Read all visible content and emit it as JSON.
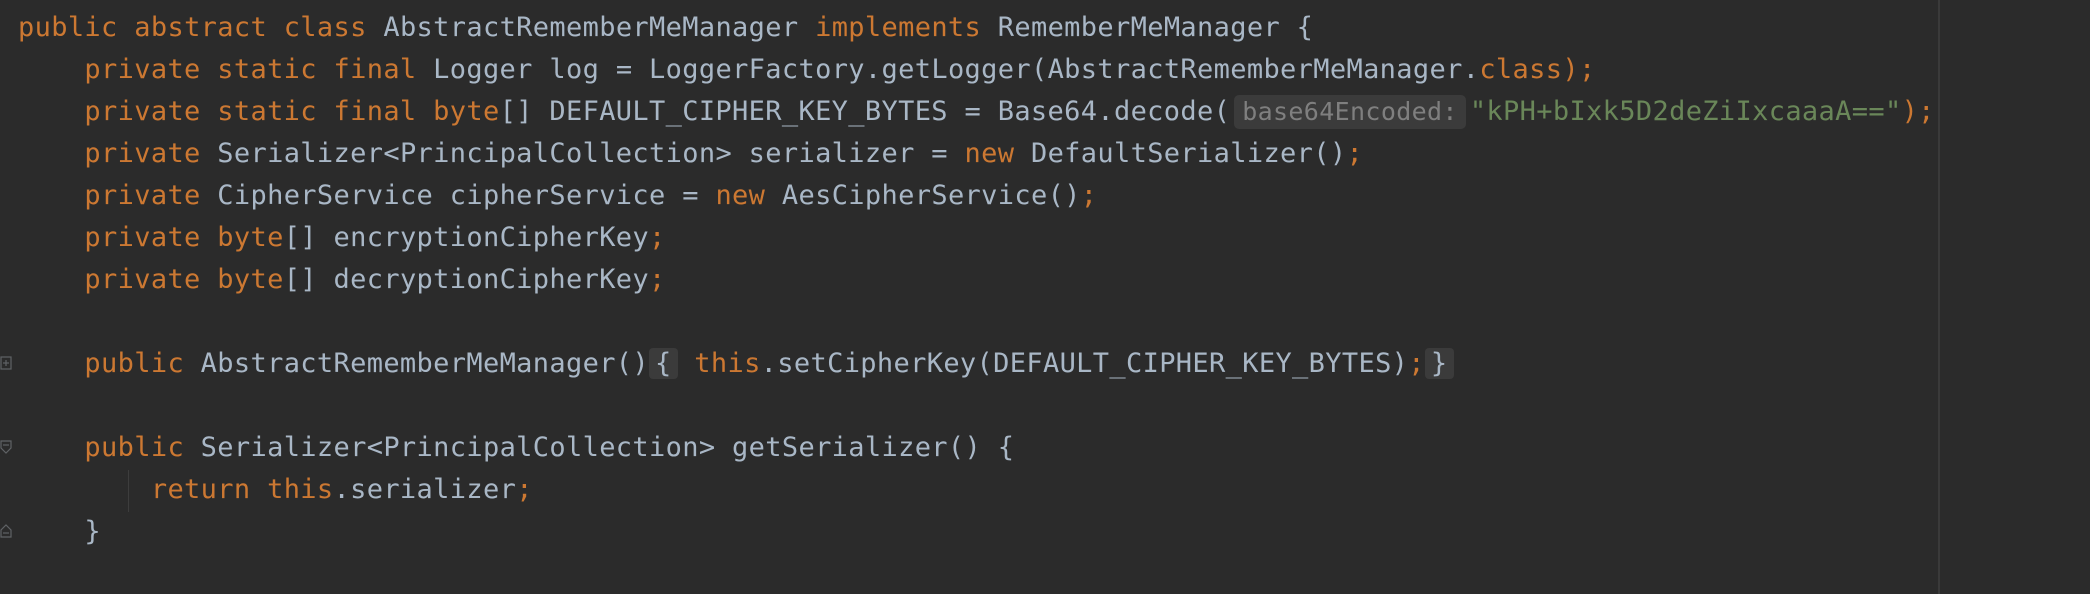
{
  "lines": {
    "l1": {
      "kw_public": "public",
      "kw_abstract": "abstract",
      "kw_class": "class",
      "class_name": "AbstractRememberMeManager",
      "kw_implements": "implements",
      "iface": "RememberMeManager",
      "brace": "{"
    },
    "l2": {
      "mods": "private static final",
      "type": "Logger",
      "name": "log",
      "eq": "=",
      "call": "LoggerFactory.getLogger(AbstractRememberMeManager.",
      "kw_class": "class",
      "end": ");"
    },
    "l3": {
      "mods": "private static final",
      "kw_byte": "byte",
      "rest1": "[] DEFAULT_CIPHER_KEY_BYTES = Base64.decode(",
      "hint": "base64Encoded:",
      "string": "\"kPH+bIxk5D2deZiIxcaaaA==\"",
      "end": ");"
    },
    "l4": {
      "mod": "private",
      "decl": "Serializer<PrincipalCollection> serializer =",
      "kw_new": "new",
      "ctor": "DefaultSerializer()",
      "semi": ";"
    },
    "l5": {
      "mod": "private",
      "decl": "CipherService cipherService =",
      "kw_new": "new",
      "ctor": "AesCipherService()",
      "semi": ";"
    },
    "l6": {
      "mod": "private",
      "kw_byte": "byte",
      "rest": "[] encryptionCipherKey",
      "semi": ";"
    },
    "l7": {
      "mod": "private",
      "kw_byte": "byte",
      "rest": "[] decryptionCipherKey",
      "semi": ";"
    },
    "l8": {
      "mod": "public",
      "sig": "AbstractRememberMeManager()",
      "open": "{",
      "kw_this": "this",
      "call": ".setCipherKey(DEFAULT_CIPHER_KEY_BYTES)",
      "semi": ";",
      "close": "}"
    },
    "l9": {
      "mod": "public",
      "sig": "Serializer<PrincipalCollection> getSerializer() {"
    },
    "l10": {
      "kw_return": "return",
      "kw_this": "this",
      "field": ".serializer",
      "semi": ";"
    },
    "l11": {
      "close": "}"
    }
  },
  "colors": {
    "background": "#2b2b2b",
    "keyword": "#cc7832",
    "text": "#a9b7c6",
    "string": "#6a8759",
    "hint_text": "#7f7f7f"
  }
}
